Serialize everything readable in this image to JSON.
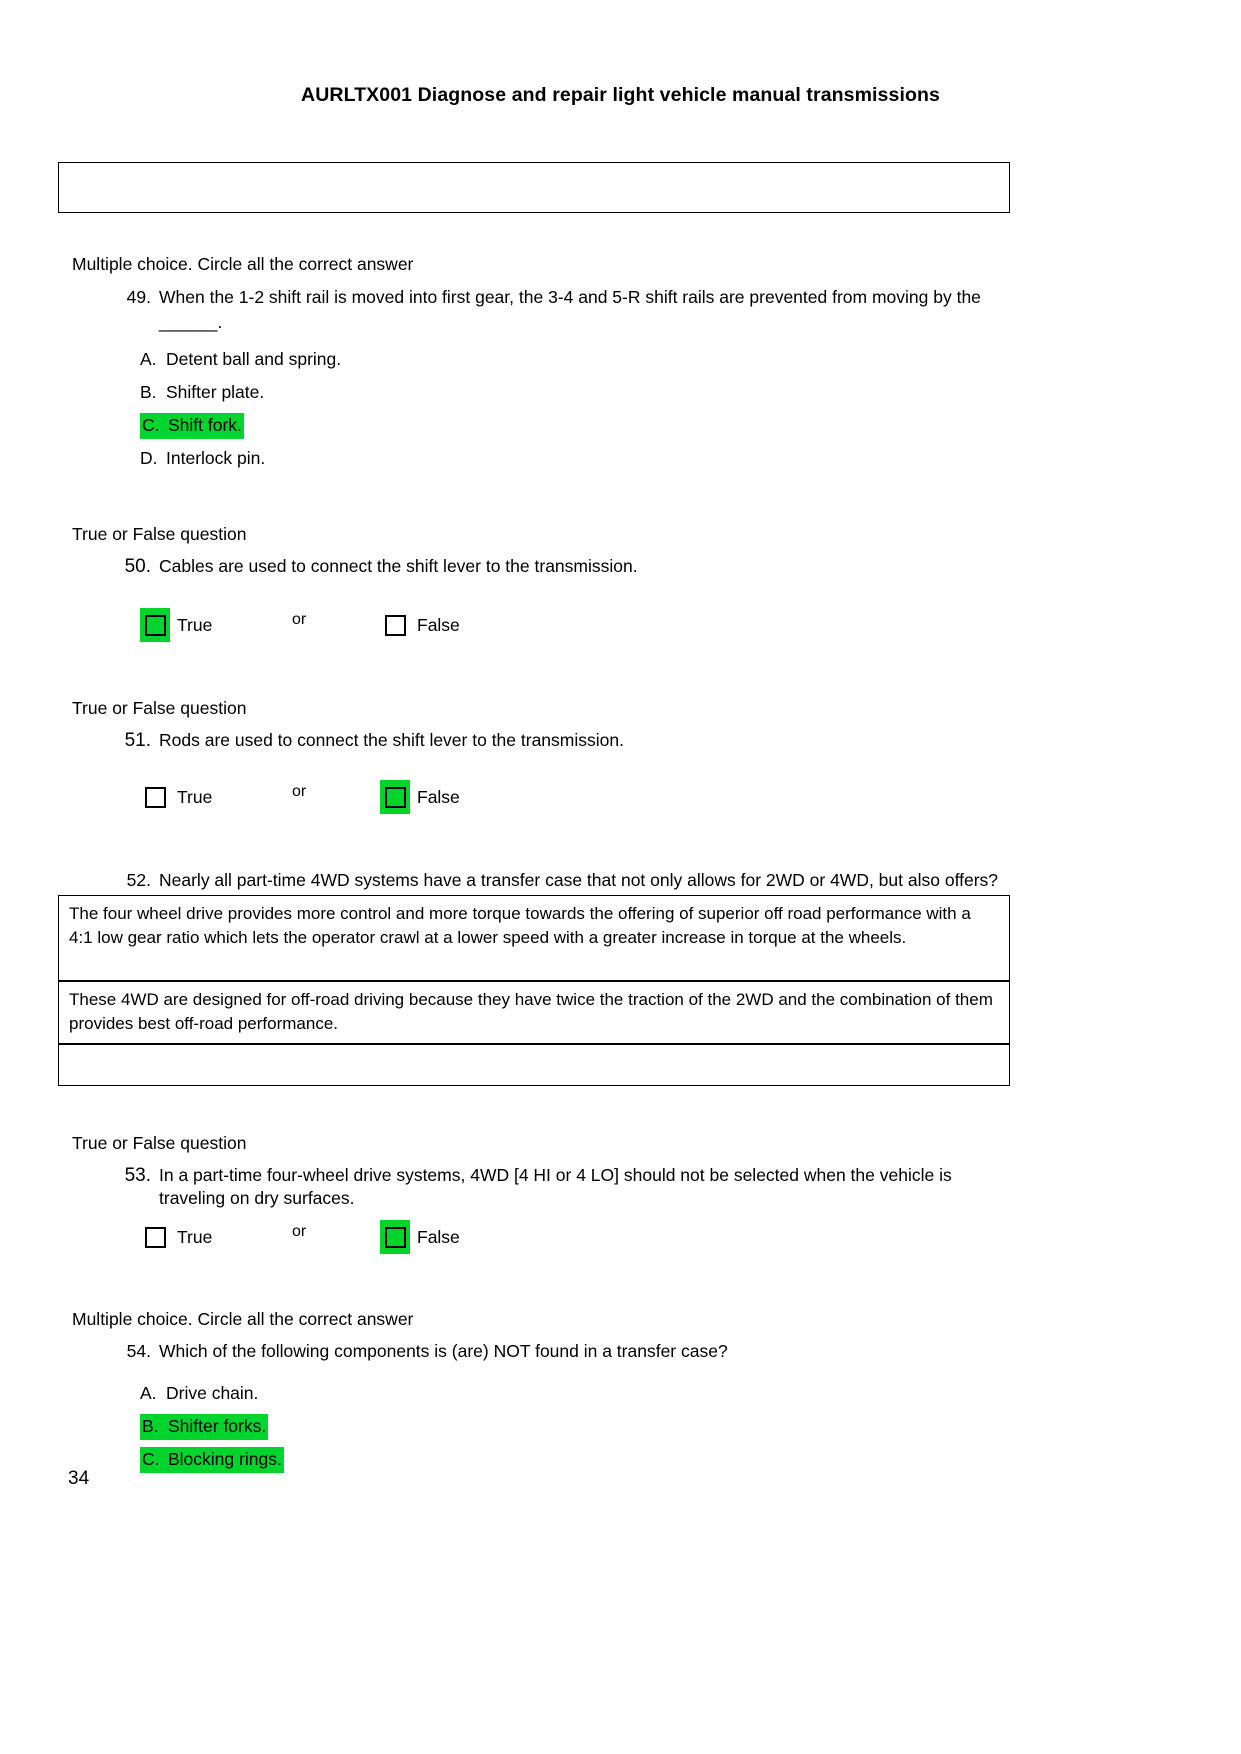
{
  "document": {
    "header_title": "AURLTX001 Diagnose and repair light vehicle manual transmissions",
    "page_number": "34",
    "highlight_color": "#00D42D"
  },
  "top_answer_box": {
    "value": ""
  },
  "sections": {
    "mc_prompt_1": "Multiple choice. Circle all the correct answer",
    "tf_prompt_1": "True or False question",
    "tf_prompt_2": "True or False question",
    "tf_prompt_3": "True or False question",
    "mc_prompt_2": "Multiple choice. Circle all the correct answer"
  },
  "questions": {
    "q49": {
      "number": "49.",
      "text_line1": "When the 1-2 shift rail is moved into first gear, the 3-4 and 5-R shift rails are prevented from moving by the",
      "text_line2": "______.",
      "options": [
        {
          "letter": "A.",
          "text": "Detent ball and spring.",
          "highlighted": false
        },
        {
          "letter": "B.",
          "text": "Shifter plate.",
          "highlighted": false
        },
        {
          "letter": "C.",
          "text": "Shift fork.",
          "highlighted": true
        },
        {
          "letter": "D.",
          "text": "Interlock pin.",
          "highlighted": false
        }
      ]
    },
    "q50": {
      "number": "50.",
      "text": "Cables are used to connect the shift lever to the transmission.",
      "true_label": "True",
      "or_label": "or",
      "false_label": "False",
      "selected": "True"
    },
    "q51": {
      "number": "51.",
      "text": "Rods are used to connect the shift lever to the transmission.",
      "true_label": "True",
      "or_label": "or",
      "false_label": "False",
      "selected": "False"
    },
    "q52": {
      "number": "52.",
      "text": "Nearly all part-time 4WD systems have a transfer case that not only allows for 2WD or 4WD, but also offers?",
      "answer_1": "The four wheel drive provides more control and more torque towards the offering of superior off road performance with a 4:1 low gear ratio which lets the operator crawl at a lower speed with a greater increase in torque at the wheels.",
      "answer_2": "These 4WD are designed for off-road driving because they have twice the traction of the 2WD and the combination of them provides best off-road performance.",
      "answer_3": ""
    },
    "q53": {
      "number": "53.",
      "text_line1": "In a part-time four-wheel drive systems, 4WD [4 HI or 4 LO] should not be selected when the vehicle is",
      "text_line2": "traveling on dry surfaces.",
      "true_label": "True",
      "or_label": "or",
      "false_label": "False",
      "selected": "False"
    },
    "q54": {
      "number": "54.",
      "text": "Which of the following components is (are) NOT found in a transfer case?",
      "options": [
        {
          "letter": "A.",
          "text": "Drive chain.",
          "highlighted": false
        },
        {
          "letter": "B.",
          "text": "Shifter forks.",
          "highlighted": true
        },
        {
          "letter": "C.",
          "text": "Blocking rings.",
          "highlighted": true
        }
      ]
    }
  }
}
